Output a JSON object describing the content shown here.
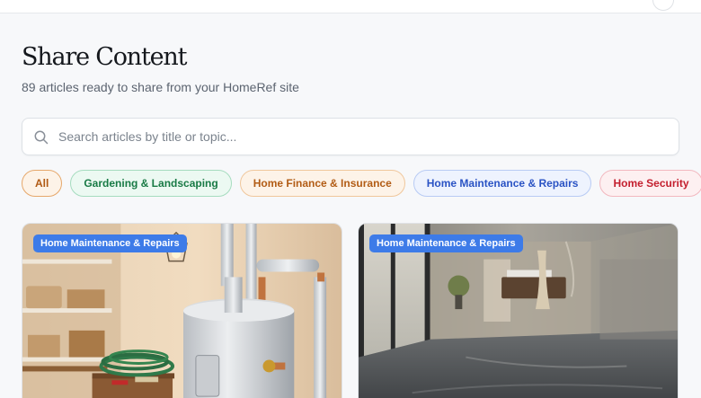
{
  "page": {
    "title": "Share Content",
    "subtitle": "89 articles ready to share from your HomeRef site"
  },
  "search": {
    "placeholder": "Search articles by title or topic...",
    "icon": "search-icon"
  },
  "filters": [
    {
      "label": "All",
      "active": true
    },
    {
      "label": "Gardening & Landscaping"
    },
    {
      "label": "Home Finance & Insurance"
    },
    {
      "label": "Home Maintenance & Repairs"
    },
    {
      "label": "Home Security"
    }
  ],
  "articles": [
    {
      "category": "Home Maintenance & Repairs",
      "image": "water heater in utility room"
    },
    {
      "category": "Home Maintenance & Repairs",
      "image": "bathroom with concrete floor and floating vanity"
    }
  ],
  "colors": {
    "accent_badge": "#3d7be8",
    "chip_all": "#b05a14",
    "chip_gardening": "#187a45",
    "chip_finance": "#b25c15",
    "chip_maintenance": "#2a53c4",
    "chip_security": "#c4202f"
  }
}
